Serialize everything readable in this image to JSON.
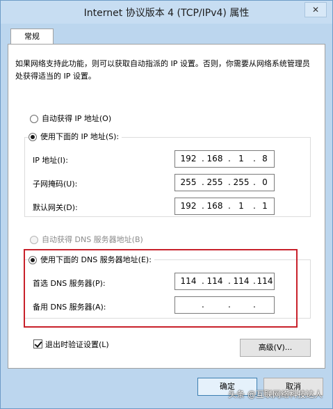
{
  "window": {
    "title": "Internet 协议版本 4 (TCP/IPv4) 属性",
    "close_symbol": "✕"
  },
  "tabs": [
    {
      "label": "常规"
    }
  ],
  "description": "如果网络支持此功能，则可以获取自动指派的 IP 设置。否则，你需要从网络系统管理员处获得适当的 IP 设置。",
  "ip_section": {
    "auto_label": "自动获得 IP 地址(O)",
    "manual_label": "使用下面的 IP 地址(S):",
    "selected": "manual",
    "fields": [
      {
        "label": "IP 地址(I):",
        "octets": [
          "192",
          "168",
          "1",
          "8"
        ]
      },
      {
        "label": "子网掩码(U):",
        "octets": [
          "255",
          "255",
          "255",
          "0"
        ]
      },
      {
        "label": "默认网关(D):",
        "octets": [
          "192",
          "168",
          "1",
          "1"
        ]
      }
    ]
  },
  "dns_section": {
    "auto_label": "自动获得 DNS 服务器地址(B)",
    "manual_label": "使用下面的 DNS 服务器地址(E):",
    "selected": "manual",
    "fields": [
      {
        "label": "首选 DNS 服务器(P):",
        "octets": [
          "114",
          "114",
          "114",
          "114"
        ]
      },
      {
        "label": "备用 DNS 服务器(A):",
        "octets": [
          "",
          "",
          "",
          ""
        ]
      }
    ]
  },
  "validate_checkbox": {
    "label": "退出时验证设置(L)",
    "checked": true
  },
  "buttons": {
    "advanced": "高级(V)...",
    "ok": "确定",
    "cancel": "取消"
  },
  "watermark": "头条 @互联网络科技达人",
  "colors": {
    "highlight_border": "#c8202a",
    "window_frame": "#bcd6ee",
    "default_button_border": "#3c7fb1"
  }
}
